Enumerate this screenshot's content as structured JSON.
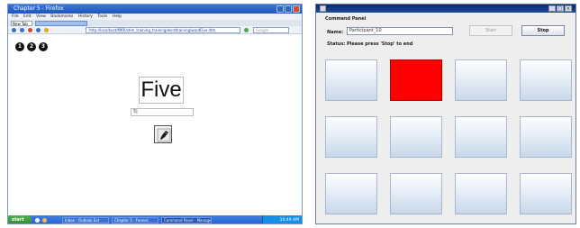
{
  "browser": {
    "title": "Chapter 5 - Firefox",
    "menu": [
      "File",
      "Edit",
      "View",
      "Bookmarks",
      "History",
      "Tools",
      "Help"
    ],
    "tab_label": "New Tab",
    "address": "http://localhost/fMRI/stim_training_training/wordtraining/wordFive.htm",
    "search_placeholder": "Google",
    "counter_circles": [
      "1",
      "2",
      "3"
    ],
    "stimulus_word": "Five",
    "answer_value": "5|"
  },
  "taskbar": {
    "start_label": "start",
    "tasks": [
      "Inbox - Outlook Ext",
      "Chapter 5 - Fennec",
      "Command Panel - Manager"
    ],
    "clock": "10:49 AM"
  },
  "panel": {
    "heading": "Command Panel",
    "name_label": "Name:",
    "name_value": "Participant_10",
    "start_label": "Start",
    "stop_label": "Stop",
    "status_label": "Status:",
    "status_text": "Please press 'Stop' to end",
    "grid": {
      "rows": 3,
      "cols": 4,
      "highlighted_index": 1,
      "highlight_color": "#ff0000"
    }
  },
  "icons": {
    "record_button": "pen-icon",
    "window_close": "close-icon"
  }
}
